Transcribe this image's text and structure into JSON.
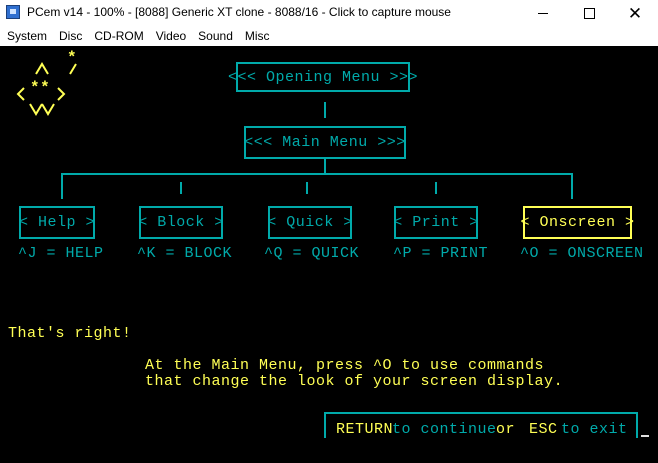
{
  "window": {
    "title": "PCem v14 - 100% - [8088] Generic XT clone - 8088/16 - Click to capture mouse",
    "minimize_glyph": "",
    "close_glyph": "✕"
  },
  "menubar": {
    "items": [
      "System",
      "Disc",
      "CD-ROM",
      "Video",
      "Sound",
      "Misc"
    ]
  },
  "screen": {
    "colors": {
      "cyan": "#00aaaa",
      "yellow": "#ffff55",
      "background": "#000000"
    },
    "logo_star": "*",
    "opening_menu": "<<< Opening Menu >>>",
    "main_menu": "<<< Main Menu >>>",
    "submenus": [
      {
        "label": "< Help >",
        "shortcut": "^J = HELP",
        "selected": false
      },
      {
        "label": "< Block >",
        "shortcut": "^K = BLOCK",
        "selected": false
      },
      {
        "label": "< Quick >",
        "shortcut": "^Q = QUICK",
        "selected": false
      },
      {
        "label": "< Print >",
        "shortcut": "^P = PRINT",
        "selected": false
      },
      {
        "label": "< Onscreen >",
        "shortcut": "^O = ONSCREEN",
        "selected": true
      }
    ],
    "feedback": "That's right!",
    "explanation_line1": "At the Main Menu, press ^O to use commands",
    "explanation_line2": "that change the look of your screen display.",
    "footer": {
      "return_key": "RETURN",
      "continue_text": "to continue",
      "or_text": "or",
      "esc_key": "ESC",
      "exit_text": "to exit"
    }
  }
}
